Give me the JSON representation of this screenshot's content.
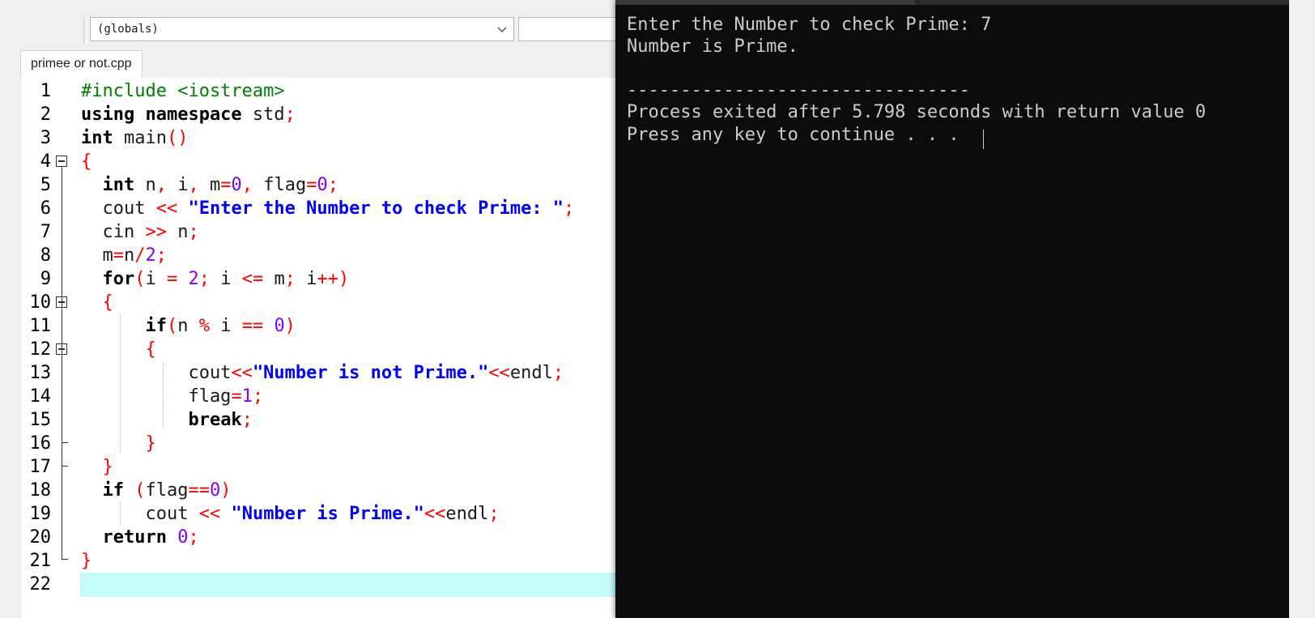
{
  "toolbar": {
    "scope_combo_value": "(globals)",
    "tab_label": "primee or not.cpp"
  },
  "editor": {
    "lines": [
      {
        "n": "1",
        "tokens": [
          {
            "t": "#include <iostream>",
            "c": "pp"
          }
        ]
      },
      {
        "n": "2",
        "tokens": [
          {
            "t": "using namespace",
            "c": "kw"
          },
          {
            "t": " std",
            "c": "plain"
          },
          {
            "t": ";",
            "c": "op"
          }
        ]
      },
      {
        "n": "3",
        "tokens": [
          {
            "t": "int",
            "c": "kw"
          },
          {
            "t": " main",
            "c": "plain"
          },
          {
            "t": "()",
            "c": "op"
          }
        ]
      },
      {
        "n": "4",
        "tokens": [
          {
            "t": "{",
            "c": "op"
          }
        ]
      },
      {
        "n": "5",
        "tokens": [
          {
            "t": "  ",
            "c": "plain"
          },
          {
            "t": "int",
            "c": "kw"
          },
          {
            "t": " n",
            "c": "plain"
          },
          {
            "t": ",",
            "c": "op"
          },
          {
            "t": " i",
            "c": "plain"
          },
          {
            "t": ",",
            "c": "op"
          },
          {
            "t": " m",
            "c": "plain"
          },
          {
            "t": "=",
            "c": "op"
          },
          {
            "t": "0",
            "c": "num"
          },
          {
            "t": ",",
            "c": "op"
          },
          {
            "t": " flag",
            "c": "plain"
          },
          {
            "t": "=",
            "c": "op"
          },
          {
            "t": "0",
            "c": "num"
          },
          {
            "t": ";",
            "c": "op"
          }
        ]
      },
      {
        "n": "6",
        "tokens": [
          {
            "t": "  cout ",
            "c": "plain"
          },
          {
            "t": "<<",
            "c": "op"
          },
          {
            "t": " ",
            "c": "plain"
          },
          {
            "t": "\"Enter the Number to check Prime: \"",
            "c": "str"
          },
          {
            "t": ";",
            "c": "op"
          }
        ]
      },
      {
        "n": "7",
        "tokens": [
          {
            "t": "  cin ",
            "c": "plain"
          },
          {
            "t": ">>",
            "c": "op"
          },
          {
            "t": " n",
            "c": "plain"
          },
          {
            "t": ";",
            "c": "op"
          }
        ]
      },
      {
        "n": "8",
        "tokens": [
          {
            "t": "  m",
            "c": "plain"
          },
          {
            "t": "=",
            "c": "op"
          },
          {
            "t": "n",
            "c": "plain"
          },
          {
            "t": "/",
            "c": "op"
          },
          {
            "t": "2",
            "c": "num"
          },
          {
            "t": ";",
            "c": "op"
          }
        ]
      },
      {
        "n": "9",
        "tokens": [
          {
            "t": "  ",
            "c": "plain"
          },
          {
            "t": "for",
            "c": "kw"
          },
          {
            "t": "(",
            "c": "op"
          },
          {
            "t": "i ",
            "c": "plain"
          },
          {
            "t": "=",
            "c": "op"
          },
          {
            "t": " ",
            "c": "plain"
          },
          {
            "t": "2",
            "c": "num"
          },
          {
            "t": ";",
            "c": "op"
          },
          {
            "t": " i ",
            "c": "plain"
          },
          {
            "t": "<=",
            "c": "op"
          },
          {
            "t": " m",
            "c": "plain"
          },
          {
            "t": ";",
            "c": "op"
          },
          {
            "t": " i",
            "c": "plain"
          },
          {
            "t": "++)",
            "c": "op"
          }
        ]
      },
      {
        "n": "10",
        "tokens": [
          {
            "t": "  ",
            "c": "plain"
          },
          {
            "t": "{",
            "c": "op"
          }
        ]
      },
      {
        "n": "11",
        "tokens": [
          {
            "t": "      ",
            "c": "plain"
          },
          {
            "t": "if",
            "c": "kw"
          },
          {
            "t": "(",
            "c": "op"
          },
          {
            "t": "n ",
            "c": "plain"
          },
          {
            "t": "%",
            "c": "op"
          },
          {
            "t": " i ",
            "c": "plain"
          },
          {
            "t": "==",
            "c": "op"
          },
          {
            "t": " ",
            "c": "plain"
          },
          {
            "t": "0",
            "c": "num"
          },
          {
            "t": ")",
            "c": "op"
          }
        ]
      },
      {
        "n": "12",
        "tokens": [
          {
            "t": "      ",
            "c": "plain"
          },
          {
            "t": "{",
            "c": "op"
          }
        ]
      },
      {
        "n": "13",
        "tokens": [
          {
            "t": "          cout",
            "c": "plain"
          },
          {
            "t": "<<",
            "c": "op"
          },
          {
            "t": "\"Number is not Prime.\"",
            "c": "str"
          },
          {
            "t": "<<",
            "c": "op"
          },
          {
            "t": "endl",
            "c": "plain"
          },
          {
            "t": ";",
            "c": "op"
          }
        ]
      },
      {
        "n": "14",
        "tokens": [
          {
            "t": "          flag",
            "c": "plain"
          },
          {
            "t": "=",
            "c": "op"
          },
          {
            "t": "1",
            "c": "num"
          },
          {
            "t": ";",
            "c": "op"
          }
        ]
      },
      {
        "n": "15",
        "tokens": [
          {
            "t": "          ",
            "c": "plain"
          },
          {
            "t": "break",
            "c": "kw"
          },
          {
            "t": ";",
            "c": "op"
          }
        ]
      },
      {
        "n": "16",
        "tokens": [
          {
            "t": "      ",
            "c": "plain"
          },
          {
            "t": "}",
            "c": "op"
          }
        ]
      },
      {
        "n": "17",
        "tokens": [
          {
            "t": "  ",
            "c": "plain"
          },
          {
            "t": "}",
            "c": "op"
          }
        ]
      },
      {
        "n": "18",
        "tokens": [
          {
            "t": "  ",
            "c": "plain"
          },
          {
            "t": "if",
            "c": "kw"
          },
          {
            "t": " ",
            "c": "plain"
          },
          {
            "t": "(",
            "c": "op"
          },
          {
            "t": "flag",
            "c": "plain"
          },
          {
            "t": "==",
            "c": "op"
          },
          {
            "t": "0",
            "c": "num"
          },
          {
            "t": ")",
            "c": "op"
          }
        ]
      },
      {
        "n": "19",
        "tokens": [
          {
            "t": "      cout ",
            "c": "plain"
          },
          {
            "t": "<<",
            "c": "op"
          },
          {
            "t": " ",
            "c": "plain"
          },
          {
            "t": "\"Number is Prime.\"",
            "c": "str"
          },
          {
            "t": "<<",
            "c": "op"
          },
          {
            "t": "endl",
            "c": "plain"
          },
          {
            "t": ";",
            "c": "op"
          }
        ]
      },
      {
        "n": "20",
        "tokens": [
          {
            "t": "  ",
            "c": "plain"
          },
          {
            "t": "return",
            "c": "kw"
          },
          {
            "t": " ",
            "c": "plain"
          },
          {
            "t": "0",
            "c": "num"
          },
          {
            "t": ";",
            "c": "op"
          }
        ]
      },
      {
        "n": "21",
        "tokens": [
          {
            "t": "}",
            "c": "op"
          }
        ]
      },
      {
        "n": "22",
        "tokens": []
      }
    ]
  },
  "console": {
    "line1": "Enter the Number to check Prime: 7",
    "line2": "Number is Prime.",
    "separator": "--------------------------------",
    "line3": "Process exited after 5.798 seconds with return value 0",
    "line4": "Press any key to continue . . ."
  },
  "colors": {
    "keyword": "#000000",
    "operator": "#ff0000",
    "string": "#0000ff",
    "number": "#8000ff",
    "preprocessor": "#008000",
    "current_line": "#c4fcfc",
    "console_bg": "#0c0c0c",
    "console_fg": "#cccccc"
  }
}
